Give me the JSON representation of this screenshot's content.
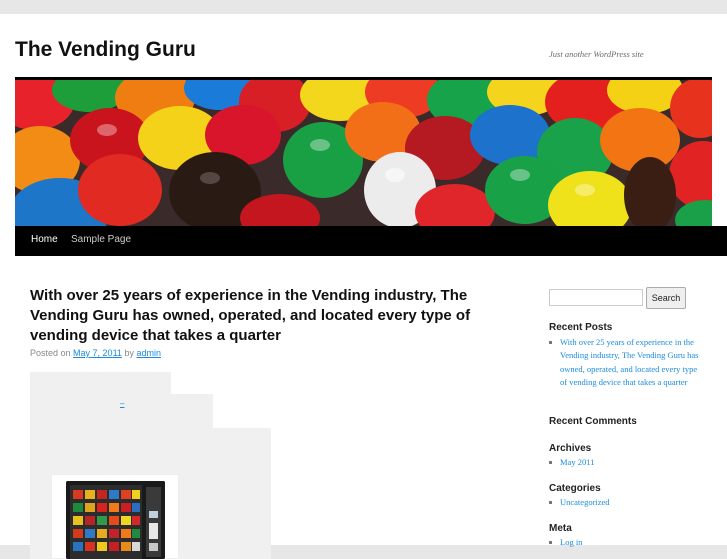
{
  "site": {
    "title": "The Vending Guru",
    "description": "Just another WordPress site"
  },
  "nav": {
    "items": [
      {
        "label": "Home"
      },
      {
        "label": "Sample Page"
      }
    ]
  },
  "post": {
    "title": "With over 25 years of experience in the Vending industry, The Vending Guru has owned, operated, and located every type of vending device that takes a quarter",
    "meta": {
      "posted_on": "Posted on",
      "date": "May 7, 2011",
      "by": "by",
      "author": "admin"
    },
    "inline_link": "–"
  },
  "sidebar": {
    "search": {
      "placeholder": "",
      "button_label": "Search"
    },
    "recent_posts": {
      "title": "Recent Posts",
      "items": [
        "With over 25 years of experience in the Vending industry, The Vending Guru has owned, operated, and located every type of vending device that takes a quarter"
      ]
    },
    "recent_comments": {
      "title": "Recent Comments"
    },
    "archives": {
      "title": "Archives",
      "items": [
        "May 2011"
      ]
    },
    "categories": {
      "title": "Categories",
      "items": [
        "Uncategorized"
      ]
    },
    "meta": {
      "title": "Meta",
      "items": [
        "Log in"
      ]
    }
  },
  "colors": {
    "link": "#1b8be0",
    "nav_bar": "#000000",
    "page_background": "#e7e7e7"
  }
}
